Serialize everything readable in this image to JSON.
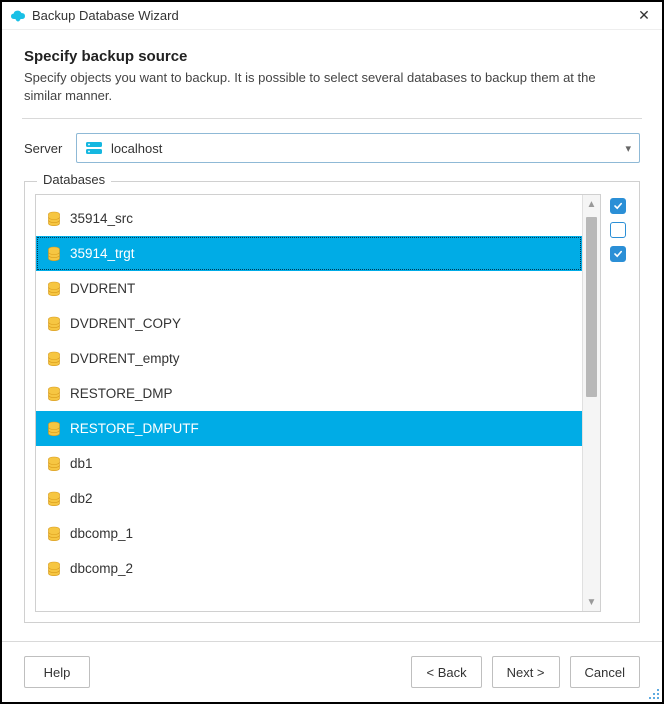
{
  "window": {
    "title": "Backup Database Wizard"
  },
  "page": {
    "heading": "Specify backup source",
    "description": "Specify objects you want to backup. It is possible to select several databases to backup them at the similar manner."
  },
  "server": {
    "label": "Server",
    "value": "localhost"
  },
  "fieldset": {
    "legend": "Databases"
  },
  "databases": [
    {
      "name": "35914_src",
      "selected": false
    },
    {
      "name": "35914_trgt",
      "selected": true,
      "focused": true
    },
    {
      "name": "DVDRENT",
      "selected": false
    },
    {
      "name": "DVDRENT_COPY",
      "selected": false
    },
    {
      "name": "DVDRENT_empty",
      "selected": false
    },
    {
      "name": "RESTORE_DMP",
      "selected": false
    },
    {
      "name": "RESTORE_DMPUTF",
      "selected": true
    },
    {
      "name": "db1",
      "selected": false
    },
    {
      "name": "db2",
      "selected": false
    },
    {
      "name": "dbcomp_1",
      "selected": false
    },
    {
      "name": "dbcomp_2",
      "selected": false
    }
  ],
  "side_checks": [
    {
      "state": "checked"
    },
    {
      "state": "unchecked"
    },
    {
      "state": "checked"
    }
  ],
  "buttons": {
    "help": "Help",
    "back": "< Back",
    "next": "Next >",
    "cancel": "Cancel"
  },
  "colors": {
    "accent": "#00ace6",
    "check": "#2b8fd6"
  }
}
